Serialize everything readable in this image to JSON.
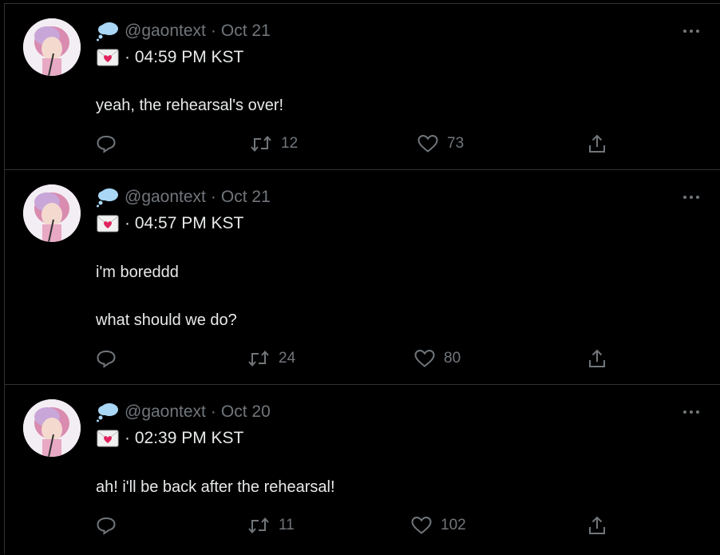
{
  "colors": {
    "background": "#000000",
    "text_primary": "#e7e9ea",
    "text_secondary": "#71767b",
    "divider": "#2f3336"
  },
  "tweets": [
    {
      "handle": "@gaontext",
      "separator": "·",
      "date": "Oct 21",
      "time_line": "· 04:59 PM KST",
      "lines": [
        "yeah, the rehearsal's over!"
      ],
      "replies": "",
      "retweets": "12",
      "likes": "73"
    },
    {
      "handle": "@gaontext",
      "separator": "·",
      "date": "Oct 21",
      "time_line": "· 04:57 PM KST",
      "lines": [
        "i'm boreddd",
        "",
        "what should we do?"
      ],
      "replies": "",
      "retweets": "24",
      "likes": "80"
    },
    {
      "handle": "@gaontext",
      "separator": "·",
      "date": "Oct 20",
      "time_line": "· 02:39 PM KST",
      "lines": [
        "ah! i'll be back after the rehearsal!"
      ],
      "replies": "",
      "retweets": "11",
      "likes": "102"
    }
  ],
  "icons": {
    "header_emoji_1": "thought-balloon-icon",
    "header_emoji_2": "love-letter-icon",
    "more": "more-horizontal-icon",
    "reply": "reply-icon",
    "retweet": "retweet-icon",
    "like": "heart-icon",
    "share": "share-icon"
  }
}
